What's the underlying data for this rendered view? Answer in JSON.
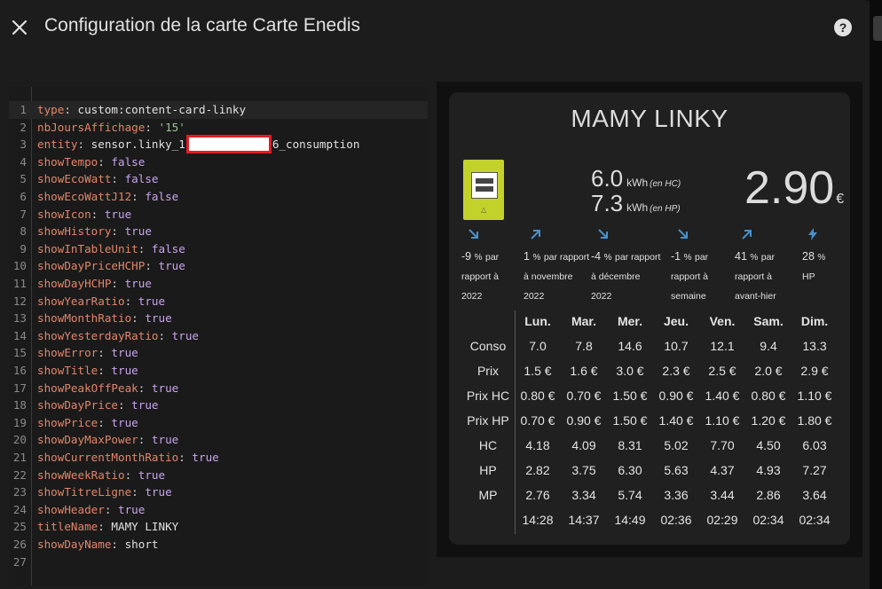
{
  "dialog": {
    "title": "Configuration de la carte Carte Enedis",
    "close_icon": "close-icon",
    "help_icon": "help-circle-icon"
  },
  "editor": {
    "lines": [
      {
        "n": "1",
        "key": "type",
        "value": "custom:content-card-linky",
        "vtype": "t"
      },
      {
        "n": "2",
        "key": "nbJoursAffichage",
        "value": "'15'",
        "vtype": "s"
      },
      {
        "n": "3",
        "key": "entity",
        "value_prefix": "sensor.linky_1",
        "value_suffix": "6_consumption",
        "vtype": "t"
      },
      {
        "n": "4",
        "key": "showTempo",
        "value": "false",
        "vtype": "v"
      },
      {
        "n": "5",
        "key": "showEcoWatt",
        "value": "false",
        "vtype": "v"
      },
      {
        "n": "6",
        "key": "showEcoWattJ12",
        "value": "false",
        "vtype": "v"
      },
      {
        "n": "7",
        "key": "showIcon",
        "value": "true",
        "vtype": "v"
      },
      {
        "n": "8",
        "key": "showHistory",
        "value": "true",
        "vtype": "v"
      },
      {
        "n": "9",
        "key": "showInTableUnit",
        "value": "false",
        "vtype": "v"
      },
      {
        "n": "10",
        "key": "showDayPriceHCHP",
        "value": "true",
        "vtype": "v"
      },
      {
        "n": "11",
        "key": "showDayHCHP",
        "value": "true",
        "vtype": "v"
      },
      {
        "n": "12",
        "key": "showYearRatio",
        "value": "true",
        "vtype": "v"
      },
      {
        "n": "13",
        "key": "showMonthRatio",
        "value": "true",
        "vtype": "v"
      },
      {
        "n": "14",
        "key": "showYesterdayRatio",
        "value": "true",
        "vtype": "v"
      },
      {
        "n": "15",
        "key": "showError",
        "value": "true",
        "vtype": "v"
      },
      {
        "n": "16",
        "key": "showTitle",
        "value": "true",
        "vtype": "v"
      },
      {
        "n": "17",
        "key": "showPeakOffPeak",
        "value": "true",
        "vtype": "v"
      },
      {
        "n": "18",
        "key": "showDayPrice",
        "value": "true",
        "vtype": "v"
      },
      {
        "n": "19",
        "key": "showPrice",
        "value": "true",
        "vtype": "v"
      },
      {
        "n": "20",
        "key": "showDayMaxPower",
        "value": "true",
        "vtype": "v"
      },
      {
        "n": "21",
        "key": "showCurrentMonthRatio",
        "value": "true",
        "vtype": "v"
      },
      {
        "n": "22",
        "key": "showWeekRatio",
        "value": "true",
        "vtype": "v"
      },
      {
        "n": "23",
        "key": "showTitreLigne",
        "value": "true",
        "vtype": "v"
      },
      {
        "n": "24",
        "key": "showHeader",
        "value": "true",
        "vtype": "v"
      },
      {
        "n": "25",
        "key": "titleName",
        "value": "MAMY LINKY",
        "vtype": "t"
      },
      {
        "n": "26",
        "key": "showDayName",
        "value": "short",
        "vtype": "t"
      },
      {
        "n": "27",
        "key": "",
        "value": "",
        "vtype": "t"
      }
    ]
  },
  "card": {
    "title": "MAMY LINKY",
    "meter_icon": "linky-meter-icon",
    "hc": {
      "value": "6.0",
      "unit": "kWh",
      "note": "(en HC)"
    },
    "hp": {
      "value": "7.3",
      "unit": "kWh",
      "note": "(en HP)"
    },
    "price": {
      "value": "2.90",
      "currency": "€"
    },
    "ratios": [
      {
        "icon": "arrow-down-right-icon",
        "value": "-9",
        "unit": "%",
        "label1": "par",
        "label2": "rapport à",
        "label3": "2022"
      },
      {
        "icon": "arrow-up-right-icon",
        "value": "1",
        "unit": "%",
        "label1": "par rapport",
        "label2": "à novembre",
        "label3": "2022"
      },
      {
        "icon": "arrow-down-right-icon",
        "value": "-4",
        "unit": "%",
        "label1": "par rapport",
        "label2": "à décembre",
        "label3": "2022"
      },
      {
        "icon": "arrow-down-right-icon",
        "value": "-1",
        "unit": "%",
        "label1": "par",
        "label2": "rapport à",
        "label3": "semaine"
      },
      {
        "icon": "arrow-up-right-icon",
        "value": "41",
        "unit": "%",
        "label1": "par",
        "label2": "rapport à",
        "label3": "avant-hier"
      },
      {
        "icon": "flash-icon",
        "value": "28",
        "unit": "%",
        "label1": "",
        "label2": "HP",
        "label3": ""
      }
    ],
    "table": {
      "days": [
        "Lun.",
        "Mar.",
        "Mer.",
        "Jeu.",
        "Ven.",
        "Sam.",
        "Dim."
      ],
      "rows": [
        {
          "label": "Conso",
          "values": [
            "7.0",
            "7.8",
            "14.6",
            "10.7",
            "12.1",
            "9.4",
            "13.3"
          ]
        },
        {
          "label": "Prix",
          "values": [
            "1.5 €",
            "1.6 €",
            "3.0 €",
            "2.3 €",
            "2.5 €",
            "2.0 €",
            "2.9 €"
          ]
        },
        {
          "label": "Prix HC",
          "values": [
            "0.80 €",
            "0.70 €",
            "1.50 €",
            "0.90 €",
            "1.40 €",
            "0.80 €",
            "1.10 €"
          ]
        },
        {
          "label": "Prix HP",
          "values": [
            "0.70 €",
            "0.90 €",
            "1.50 €",
            "1.40 €",
            "1.10 €",
            "1.20 €",
            "1.80 €"
          ]
        },
        {
          "label": "HC",
          "values": [
            "4.18",
            "4.09",
            "8.31",
            "5.02",
            "7.70",
            "4.50",
            "6.03"
          ]
        },
        {
          "label": "HP",
          "values": [
            "2.82",
            "3.75",
            "6.30",
            "5.63",
            "4.37",
            "4.93",
            "7.27"
          ]
        },
        {
          "label": "MP",
          "values": [
            "2.76",
            "3.34",
            "5.74",
            "3.36",
            "3.44",
            "2.86",
            "3.64"
          ]
        },
        {
          "label": "",
          "values": [
            "14:28",
            "14:37",
            "14:49",
            "02:36",
            "02:29",
            "02:34",
            "02:34"
          ]
        }
      ]
    },
    "colors": {
      "meter": "#c3d22b",
      "arrow": "#4a90c8"
    }
  }
}
